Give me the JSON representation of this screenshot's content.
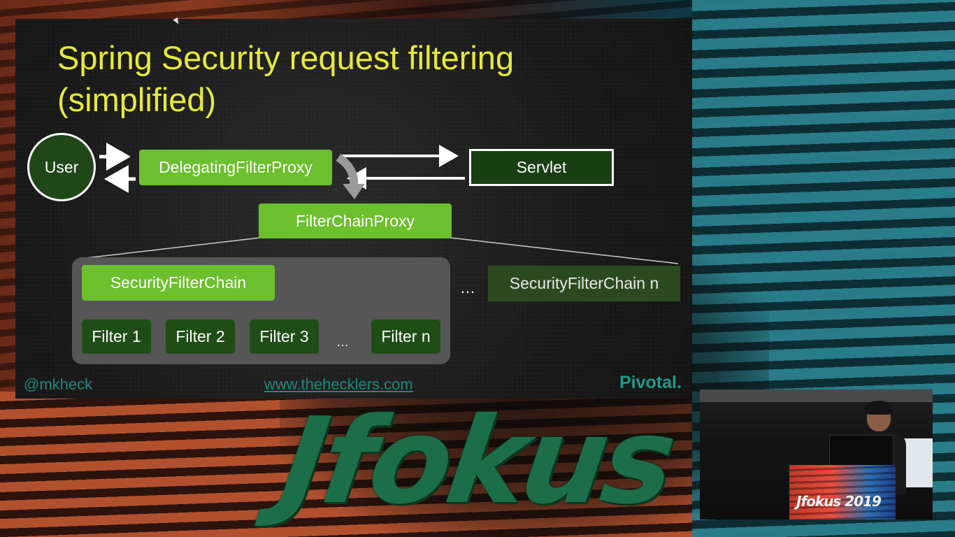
{
  "slide": {
    "title_line1": "Spring Security request filtering",
    "title_line2": "(simplified)",
    "user_label": "User",
    "delegating_filter_proxy": "DelegatingFilterProxy",
    "servlet": "Servlet",
    "filter_chain_proxy": "FilterChainProxy",
    "security_filter_chain": "SecurityFilterChain",
    "security_filter_chain_n": "SecurityFilterChain n",
    "chain_ellipsis": "…",
    "filters_ellipsis": "…",
    "filters": [
      "Filter 1",
      "Filter 2",
      "Filter 3",
      "Filter n"
    ],
    "footer_handle": "@mkheck",
    "footer_url": "www.thehecklers.com",
    "footer_brand": "Pivotal."
  },
  "stage": {
    "logo_text": "Jfokus",
    "camera_podium_text": "Jfokus 2019"
  },
  "colors": {
    "title": "#e6ea3a",
    "green_box": "#6cbf2d",
    "dark_box": "#1f4d16",
    "footer": "#1c8a7c"
  }
}
